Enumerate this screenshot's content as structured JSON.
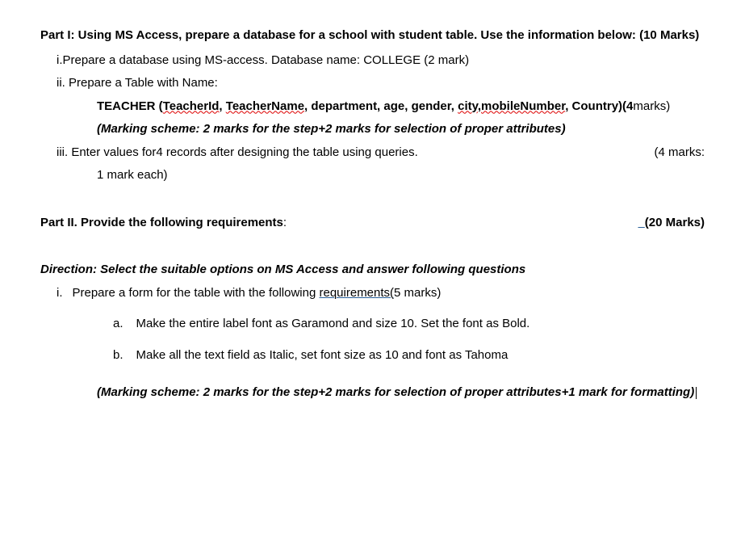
{
  "part1": {
    "heading": "Part I: Using MS Access, prepare a database for a school with student table. Use the information below:   (10 Marks)",
    "i": "i.Prepare a database using MS-access. Database name: COLLEGE (2 mark)",
    "ii": "ii.  Prepare a Table with Name:",
    "teacher_lead": "TEACHER  (",
    "teacher_id": "TeacherId",
    "comma1": ",  ",
    "teacher_name": "TeacherName",
    "comma2": ",  department,  age,  gender,  ",
    "city": "city",
    "comma3": ",",
    "mobile": "mobileNumber",
    "comma4": ", Country)(4",
    "marks_text": "marks)",
    "scheme": "(Marking  scheme:  2  marks  for  the  step+2  marks  for  selection  of  proper attributes)",
    "iii_left": "iii.  Enter values for4 records after designing the table using queries.",
    "iii_right": "(4 marks:",
    "iii_cont": "1 mark each)"
  },
  "part2": {
    "heading_left": "Part II. Provide the following requirements",
    "colon": ":",
    "marks_right": "(20 Marks)",
    "direction": "Direction: Select the suitable options on MS Access and answer following questions",
    "i_marker": "i.",
    "i_text_a": "Prepare a form for the table with the following ",
    "i_req": "requirements(",
    "i_text_b": "5 marks)",
    "a_marker": "a.",
    "a_text": "Make the   entire label font as Garamond and size 10. Set the font as    Bold.",
    "b_marker": "b.",
    "b_text": "Make all the text field as Italic, set font size as 10 and font as   Tahoma",
    "scheme": "(Marking scheme: 2 marks for the step+2 marks for selection of proper attributes+1 mark for formatting)"
  }
}
